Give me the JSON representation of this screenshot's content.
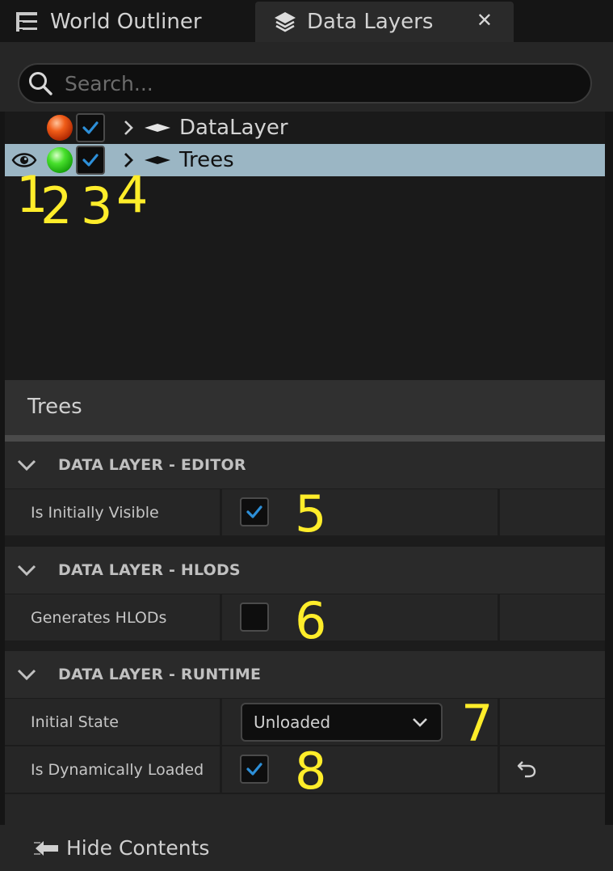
{
  "tabs": [
    {
      "label": "World Outliner",
      "icon": "outliner-icon",
      "active": false
    },
    {
      "label": "Data Layers",
      "icon": "layers-icon",
      "active": true,
      "close": "✕"
    }
  ],
  "search": {
    "placeholder": "Search...",
    "value": ""
  },
  "layers": [
    {
      "name": "DataLayer",
      "status_color": "#e84a12",
      "checked": true,
      "visible_icon": false,
      "selected": false
    },
    {
      "name": "Trees",
      "status_color": "#36d020",
      "checked": true,
      "visible_icon": true,
      "selected": true
    }
  ],
  "callouts": [
    "1",
    "2",
    "3",
    "4",
    "5",
    "6",
    "7",
    "8"
  ],
  "details": {
    "title": "Trees",
    "categories": [
      {
        "label": "DATA LAYER - EDITOR"
      },
      {
        "label": "DATA LAYER - HLODS"
      },
      {
        "label": "DATA LAYER - RUNTIME"
      }
    ],
    "properties": {
      "is_initially_visible": {
        "label": "Is Initially Visible",
        "checked": true
      },
      "generates_hlods": {
        "label": "Generates HLODs",
        "checked": false
      },
      "initial_state": {
        "label": "Initial State",
        "value": "Unloaded"
      },
      "is_dynamically_loaded": {
        "label": "Is Dynamically Loaded",
        "checked": true
      }
    }
  },
  "footer": {
    "hide_contents": "Hide Contents"
  },
  "colors": {
    "accent_check": "#2d8fd8",
    "selected_row": "#9bb6c4",
    "callout": "#ffed2a"
  }
}
